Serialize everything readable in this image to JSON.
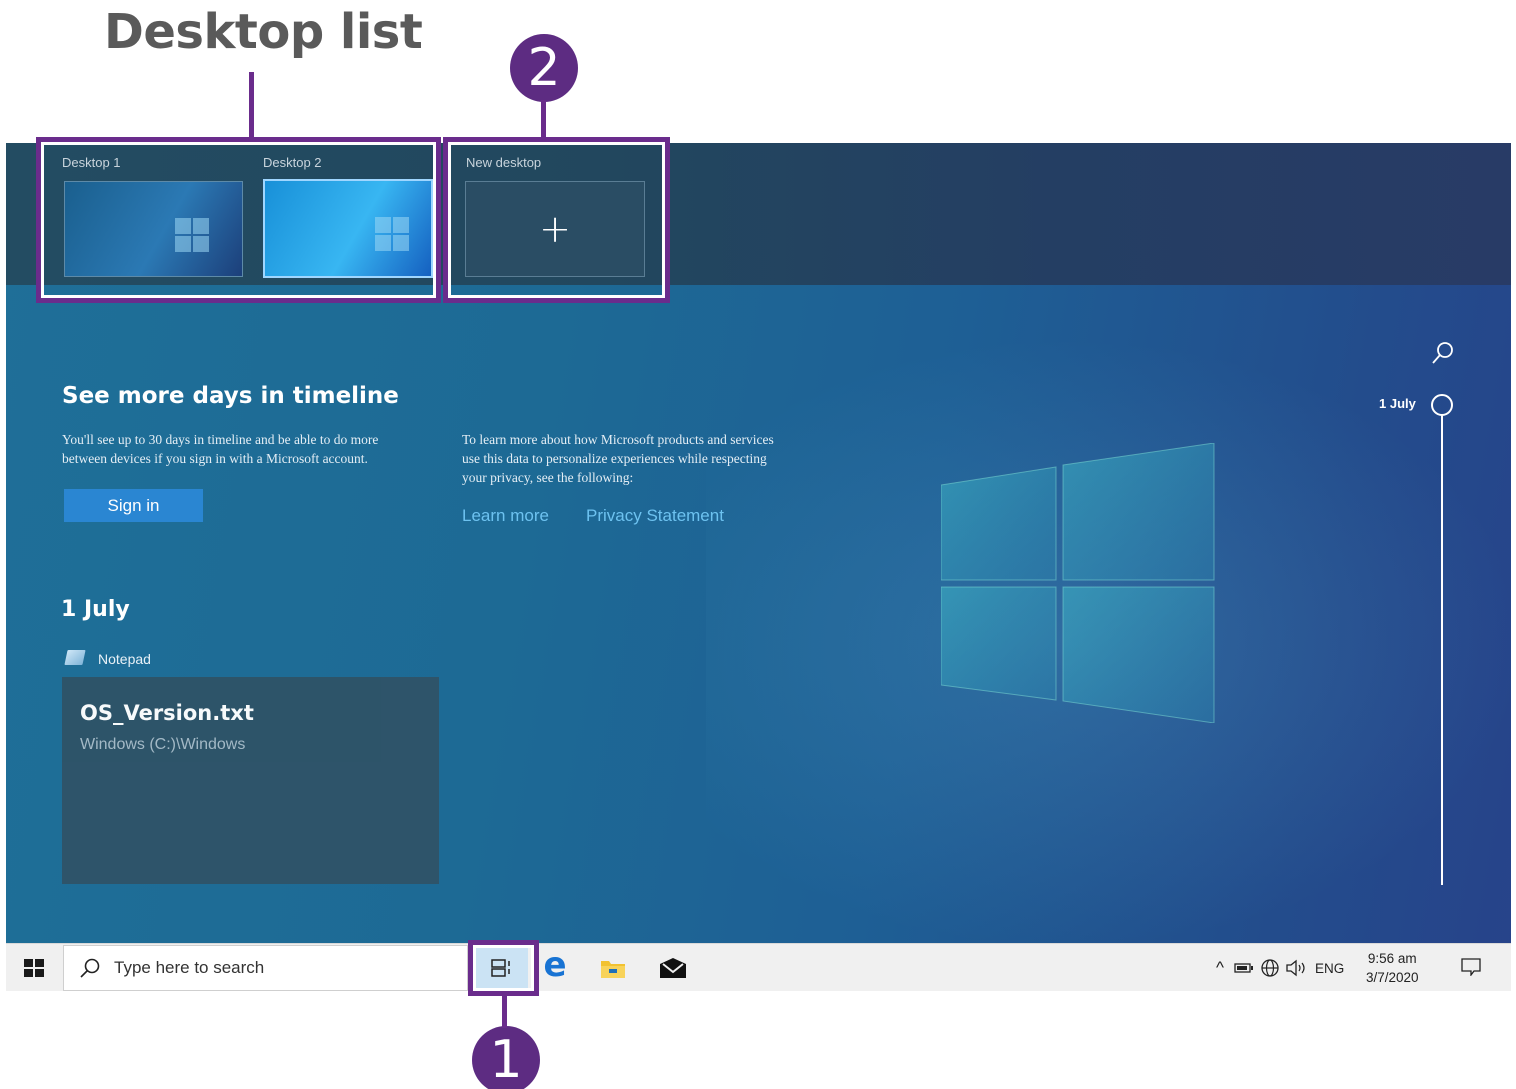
{
  "annotations": {
    "desktop_list_title": "Desktop list",
    "marker_1": "1",
    "marker_2": "2"
  },
  "desktops": [
    {
      "label": "Desktop 1",
      "active": false
    },
    {
      "label": "Desktop 2",
      "active": true
    }
  ],
  "new_desktop": {
    "label": "New desktop",
    "icon": "plus-icon"
  },
  "timeline_prompt": {
    "heading": "See more days in timeline",
    "text_line1": "You'll see up to 30 days in timeline and be able to do more",
    "text_line2": "between devices if you sign in with a Microsoft account.",
    "privacy_line1": "To learn more about how Microsoft products and services",
    "privacy_line2": "use this data to personalize experiences while respecting",
    "privacy_line3": "your privacy, see the following:",
    "sign_in_label": "Sign in",
    "learn_more_label": "Learn more",
    "privacy_statement_label": "Privacy Statement"
  },
  "activity": {
    "day_heading": "1 July",
    "app_name": "Notepad",
    "card_title": "OS_Version.txt",
    "card_path": "Windows (C:)\\Windows"
  },
  "timeline_scrubber": {
    "date": "1 July",
    "icon": "search-icon"
  },
  "taskbar": {
    "search_placeholder": "Type here to search",
    "language": "ENG",
    "time": "9:56 am",
    "date": "3/7/2020",
    "tray_caret": "^"
  },
  "colors": {
    "accent_purple": "#6a2c8c",
    "sign_in_blue": "#2a86d2",
    "link_blue": "#6dc2f0"
  }
}
